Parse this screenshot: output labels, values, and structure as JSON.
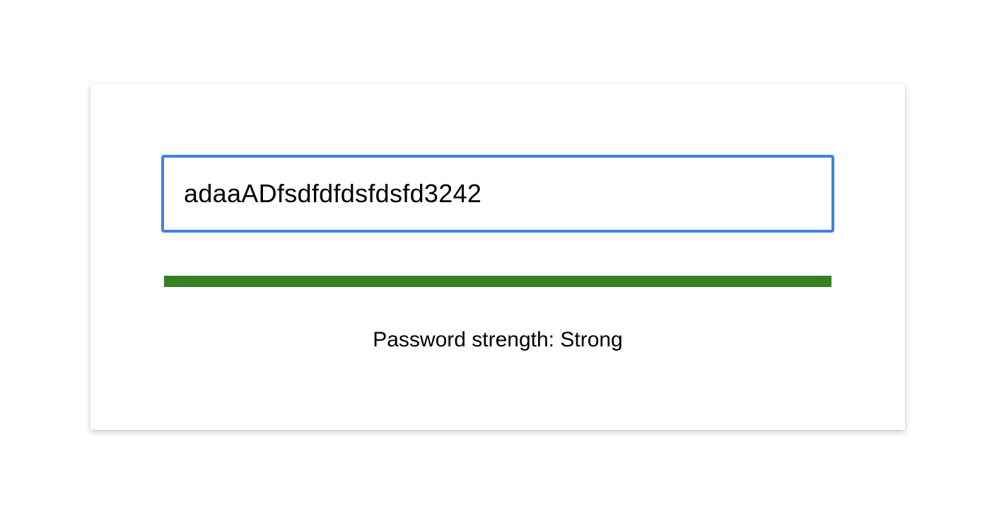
{
  "password_field": {
    "value": "adaaADfsdfdfdsfdsfd3242",
    "border_color": "#3c82e6"
  },
  "strength_meter": {
    "level_fraction": 1.0,
    "fill_color": "#378023"
  },
  "strength_label": "Password strength: Strong"
}
